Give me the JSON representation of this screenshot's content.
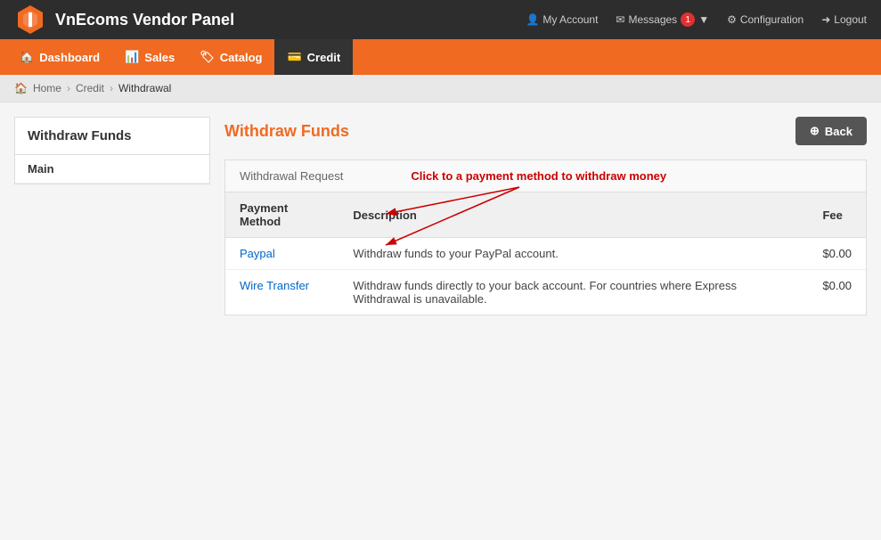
{
  "brand": {
    "name": "VnEcoms Vendor Panel"
  },
  "top_nav": {
    "my_account": "My Account",
    "messages": "Messages",
    "messages_count": "1",
    "configuration": "Configuration",
    "logout": "Logout"
  },
  "main_nav": {
    "items": [
      {
        "id": "dashboard",
        "label": "Dashboard",
        "icon": "🏠",
        "active": false
      },
      {
        "id": "sales",
        "label": "Sales",
        "icon": "📊",
        "active": false
      },
      {
        "id": "catalog",
        "label": "Catalog",
        "icon": "🏷",
        "active": false
      },
      {
        "id": "credit",
        "label": "Credit",
        "icon": "💳",
        "active": true
      }
    ]
  },
  "breadcrumb": {
    "items": [
      "Home",
      "Credit",
      "Withdrawal"
    ]
  },
  "sidebar": {
    "title": "Withdraw Funds",
    "menu_items": [
      {
        "label": "Main"
      }
    ]
  },
  "page": {
    "title": "Withdraw Funds",
    "back_button": "Back",
    "panel_title": "Withdrawal Request",
    "click_hint": "Click to a payment method to withdraw money",
    "table": {
      "headers": [
        "Payment Method",
        "Description",
        "Fee"
      ],
      "rows": [
        {
          "method": "Paypal",
          "description": "Withdraw funds to your PayPal account.",
          "fee": "$0.00"
        },
        {
          "method": "Wire Transfer",
          "description": "Withdraw funds directly to your back account. For countries where Express Withdrawal is unavailable.",
          "fee": "$0.00"
        }
      ]
    }
  }
}
